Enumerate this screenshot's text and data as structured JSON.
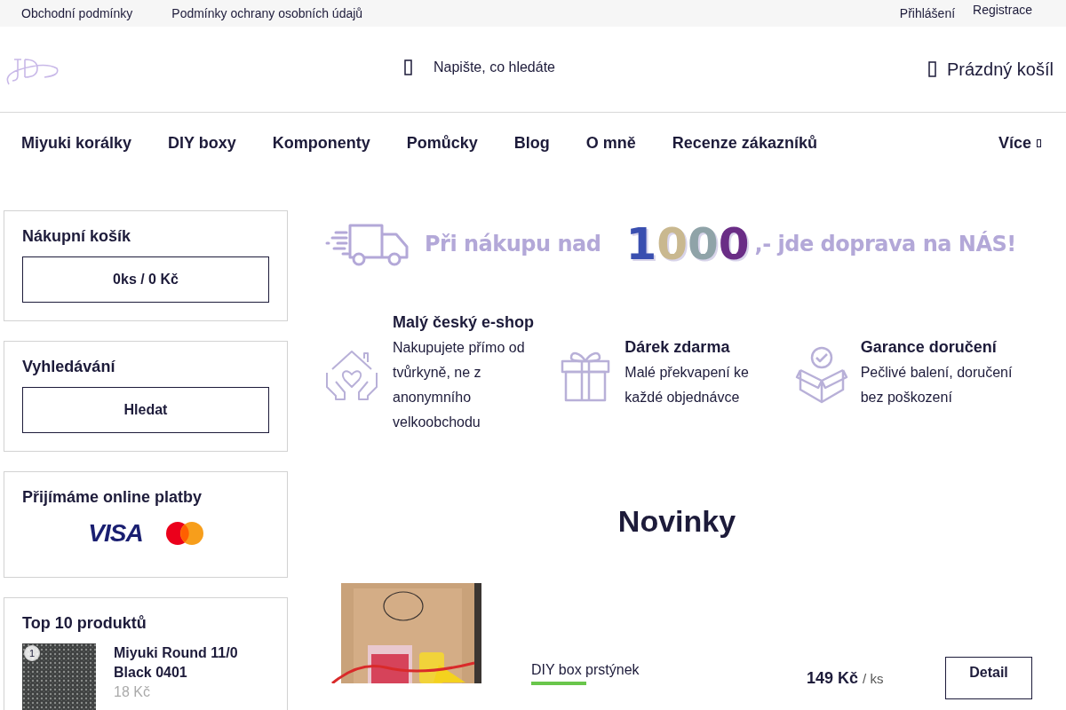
{
  "top_links": [
    "Obchodní podmínky",
    "Podmínky ochrany osobních údajů"
  ],
  "account_links": [
    "Přihlášení",
    "Registrace"
  ],
  "search": {
    "placeholder": "Napište, co hledáte"
  },
  "cart": {
    "label": "Prázdný košíl"
  },
  "nav": [
    {
      "label": "Miyuki korálky"
    },
    {
      "label": "DIY boxy"
    },
    {
      "label": "Komponenty"
    },
    {
      "label": "Pomůcky"
    },
    {
      "label": "Blog"
    },
    {
      "label": "O mně"
    },
    {
      "label": "Recenze zákazníků"
    }
  ],
  "nav_more": "Více",
  "sidebar": {
    "cart": {
      "title": "Nákupní košík",
      "button": "0ks / 0 Kč"
    },
    "search": {
      "title": "Vyhledávání",
      "button": "Hledat"
    },
    "payments": {
      "title": "Přijímáme online platby",
      "visa": "VISA"
    },
    "top": {
      "title": "Top 10 produktů",
      "items": [
        {
          "rank": "1",
          "name": "Miyuki Round 11/0 Black 0401",
          "price": "18 Kč"
        }
      ]
    }
  },
  "banner": {
    "lead": "Při nákupu nad",
    "amount": "1000",
    "tail": ",- jde doprava na NÁS!"
  },
  "features": [
    {
      "kind": "home",
      "title": "Malý český e-shop",
      "text": "Nakupujete přímo od tvůrkyně, ne z anonymního velkoobchodu"
    },
    {
      "kind": "gift",
      "title": "Dárek zdarma",
      "text": "Malé překvapení ke každé objednávce"
    },
    {
      "kind": "box",
      "title": "Garance doručení",
      "text": "Pečlivé balení, doručení bez poškození"
    }
  ],
  "section_title": "Novinky",
  "products": [
    {
      "kind": "picture",
      "name": "DIY box prstýnek",
      "price": "149 Kč",
      "unit": "/ ks",
      "button": "Detail"
    }
  ]
}
